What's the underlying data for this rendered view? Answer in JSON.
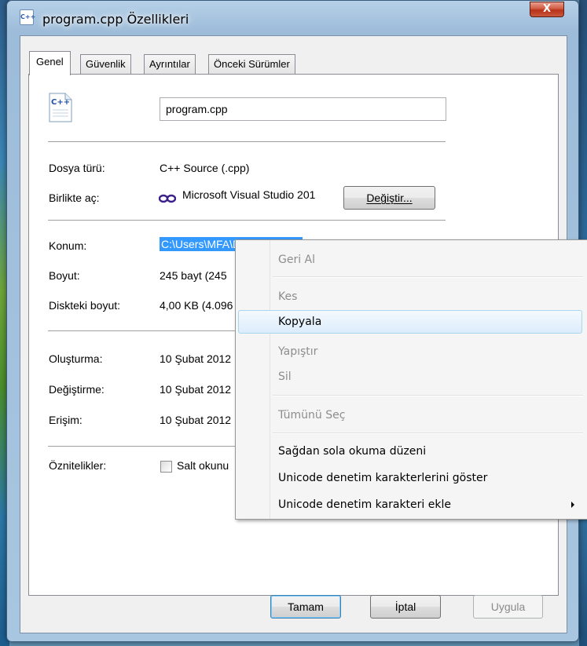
{
  "window": {
    "title": "program.cpp Özellikleri",
    "title_icon_text": "C++",
    "close_glyph": "X"
  },
  "tabs": [
    {
      "label": "Genel",
      "active": true
    },
    {
      "label": "Güvenlik",
      "active": false
    },
    {
      "label": "Ayrıntılar",
      "active": false
    },
    {
      "label": "Önceki Sürümler",
      "active": false
    }
  ],
  "file": {
    "icon_text": "C++",
    "name": "program.cpp"
  },
  "rows": {
    "type_label": "Dosya türü:",
    "type_value": "C++ Source (.cpp)",
    "openwith_label": "Birlikte aç:",
    "openwith_value": "Microsoft Visual Studio 201",
    "change_button": "Değiştir...",
    "location_label": "Konum:",
    "location_value": "C:\\Users\\MFA\\Desktop",
    "size_label": "Boyut:",
    "size_value": "245 bayt (245",
    "disk_size_label": "Diskteki boyut:",
    "disk_size_value": "4,00 KB (4.096",
    "created_label": "Oluşturma:",
    "created_value": "10 Şubat 2012",
    "modified_label": "Değiştirme:",
    "modified_value": "10 Şubat 2012",
    "accessed_label": "Erişim:",
    "accessed_value": "10 Şubat 2012",
    "attributes_label": "Öznitelikler:",
    "readonly_label": "Salt okunu"
  },
  "buttons": {
    "ok": "Tamam",
    "cancel": "İptal",
    "apply": "Uygula"
  },
  "context_menu": {
    "undo": "Geri Al",
    "cut": "Kes",
    "copy": "Kopyala",
    "paste": "Yapıştır",
    "delete": "Sil",
    "select_all": "Tümünü Seç",
    "rtl": "Sağdan sola okuma düzeni",
    "show_unicode": "Unicode denetim karakterlerini göster",
    "insert_unicode": "Unicode denetim karakteri ekle"
  },
  "colors": {
    "selection": "#3399ff",
    "menu_hover": "#dcecfc",
    "disabled_text": "#8d8d8d"
  }
}
